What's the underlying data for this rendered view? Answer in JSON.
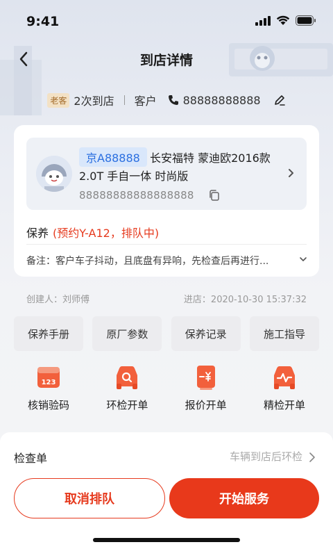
{
  "status": {
    "time": "9:41"
  },
  "nav": {
    "title": "到店详情"
  },
  "visit": {
    "badge": "老客",
    "count_text": "2次到店",
    "customer_label": "客户",
    "phone": "88888888888"
  },
  "vehicle": {
    "plate": "京A88888",
    "model_line1": "长安福特 蒙迪欧2016款",
    "model_line2": "2.0T 手自一体 时尚版",
    "vin": "88888888888888888"
  },
  "service": {
    "label": "保养",
    "status": "(预约Y-A12，排队中)"
  },
  "remark": {
    "text": "备注：客户车子抖动，且底盘有异响，先检查后再进行..."
  },
  "meta": {
    "creator": "创建人：刘师傅",
    "arrival": "进店：2020-10-30 15:37:32"
  },
  "quick_buttons": [
    "保养手册",
    "原厂参数",
    "保养记录",
    "施工指导"
  ],
  "actions": [
    {
      "label": "核销验码",
      "icon": "ticket-123-icon"
    },
    {
      "label": "环检开单",
      "icon": "car-inspect-icon"
    },
    {
      "label": "报价开单",
      "icon": "quote-icon"
    },
    {
      "label": "精检开单",
      "icon": "precision-check-icon"
    }
  ],
  "checklist": {
    "label": "检查单",
    "value": "车辆到店后环检"
  },
  "footer": {
    "cancel_label": "取消排队",
    "start_label": "开始服务"
  },
  "colors": {
    "accent": "#e8391b",
    "plate_blue": "#2b6fe0",
    "badge_gold": "#a36b2a"
  }
}
